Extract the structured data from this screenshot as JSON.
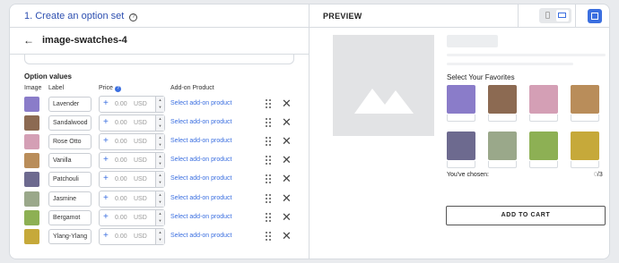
{
  "header": {
    "title": "1. Create an option set",
    "help_icon": "?"
  },
  "subheader": {
    "back_icon": "←",
    "title": "image-swatches-4"
  },
  "option_values": {
    "title": "Option values",
    "columns": {
      "image": "Image",
      "label": "Label",
      "price": "Price",
      "price_help": "?",
      "addon": "Add-on Product"
    },
    "rows": [
      {
        "label": "Lavender",
        "price": "0.00",
        "currency": "USD",
        "addon": "Select add-on product",
        "color": "#8a7cc9"
      },
      {
        "label": "Sandalwood",
        "price": "0.00",
        "currency": "USD",
        "addon": "Select add-on product",
        "color": "#8c6a52"
      },
      {
        "label": "Rose Otto",
        "price": "0.00",
        "currency": "USD",
        "addon": "Select add-on product",
        "color": "#d49fb5"
      },
      {
        "label": "Vanilla",
        "price": "0.00",
        "currency": "USD",
        "addon": "Select add-on product",
        "color": "#b98d5a"
      },
      {
        "label": "Patchouli",
        "price": "0.00",
        "currency": "USD",
        "addon": "Select add-on product",
        "color": "#6d6a8f"
      },
      {
        "label": "Jasmine",
        "price": "0.00",
        "currency": "USD",
        "addon": "Select add-on product",
        "color": "#9aa88a"
      },
      {
        "label": "Bergamot",
        "price": "0.00",
        "currency": "USD",
        "addon": "Select add-on product",
        "color": "#8db054"
      },
      {
        "label": "Ylang-Ylang",
        "price": "0.00",
        "currency": "USD",
        "addon": "Select add-on product",
        "color": "#c6a93a"
      }
    ]
  },
  "preview": {
    "label": "PREVIEW",
    "select_title": "Select Your Favorites",
    "swatch_colors": [
      "#8a7cc9",
      "#8c6a52",
      "#d49fb5",
      "#b98d5a",
      "#6d6a8f",
      "#9aa88a",
      "#8db054",
      "#c6a93a"
    ],
    "chosen_label": "You've chosen:",
    "chosen_count": "0",
    "chosen_max": "/3",
    "add_to_cart": "ADD TO CART"
  },
  "colors": {
    "accent": "#3b6fe0",
    "title": "#2d4fb0"
  }
}
